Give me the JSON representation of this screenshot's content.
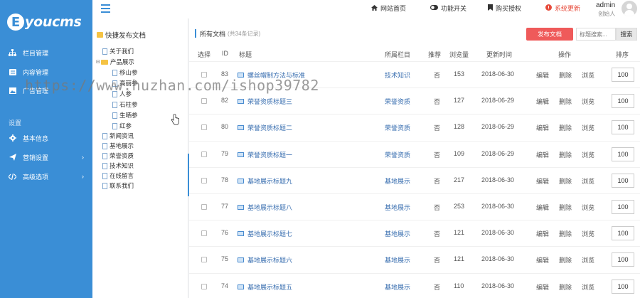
{
  "brand": {
    "logo_letter": "E",
    "logo_text": "youcms"
  },
  "sidebar": {
    "items": [
      {
        "label": "栏目管理",
        "icon": "sitemap-icon"
      },
      {
        "label": "内容管理",
        "icon": "list-icon"
      },
      {
        "label": "广告管理",
        "icon": "image-icon"
      }
    ],
    "section_label": "设置",
    "settings_items": [
      {
        "label": "基本信息",
        "icon": "gear-icon"
      },
      {
        "label": "营销设置",
        "icon": "send-icon"
      },
      {
        "label": "高级选项",
        "icon": "code-icon"
      }
    ]
  },
  "topbar": {
    "links": [
      {
        "label": "网站首页",
        "icon": "home-icon"
      },
      {
        "label": "功能开关",
        "icon": "toggle-icon"
      },
      {
        "label": "购买授权",
        "icon": "bookmark-icon"
      },
      {
        "label": "系统更新",
        "icon": "alert-icon"
      }
    ],
    "admin_name": "admin",
    "admin_role": "创始人"
  },
  "tree": {
    "title": "快捷发布文档",
    "nodes": [
      {
        "label": "关于我们"
      },
      {
        "label": "产品展示"
      },
      {
        "label": "移山参"
      },
      {
        "label": "高丽参"
      },
      {
        "label": "人参"
      },
      {
        "label": "石柱参"
      },
      {
        "label": "生晒参"
      },
      {
        "label": "红参"
      },
      {
        "label": "新闻资讯"
      },
      {
        "label": "基地展示"
      },
      {
        "label": "荣誉资质"
      },
      {
        "label": "技术知识"
      },
      {
        "label": "在线留言"
      },
      {
        "label": "联系我们"
      }
    ]
  },
  "content": {
    "breadcrumb": "所有文档",
    "record_count": "(共34条记录)",
    "publish_button": "发布文档",
    "search_placeholder": "标题搜索...",
    "search_button": "搜索",
    "columns": {
      "select": "选择",
      "id": "ID",
      "title": "标题",
      "category": "所属栏目",
      "recommend": "推荐",
      "views": "浏览量",
      "updated": "更新时间",
      "ops": "操作",
      "sort": "排序"
    },
    "op_labels": {
      "edit": "编辑",
      "delete": "删除",
      "view": "浏览"
    },
    "rows": [
      {
        "id": "83",
        "title": "螺丝帽制方法与标准",
        "category": "技术知识",
        "recommend": "否",
        "views": "153",
        "updated": "2018-06-30",
        "sort": "100"
      },
      {
        "id": "82",
        "title": "荣誉资质标题三",
        "category": "荣誉资质",
        "recommend": "否",
        "views": "127",
        "updated": "2018-06-29",
        "sort": "100"
      },
      {
        "id": "80",
        "title": "荣誉资质标题二",
        "category": "荣誉资质",
        "recommend": "否",
        "views": "128",
        "updated": "2018-06-29",
        "sort": "100"
      },
      {
        "id": "79",
        "title": "荣誉资质标题一",
        "category": "荣誉资质",
        "recommend": "否",
        "views": "109",
        "updated": "2018-06-29",
        "sort": "100"
      },
      {
        "id": "78",
        "title": "基地展示标题九",
        "category": "基地展示",
        "recommend": "否",
        "views": "217",
        "updated": "2018-06-30",
        "sort": "100"
      },
      {
        "id": "77",
        "title": "基地展示标题八",
        "category": "基地展示",
        "recommend": "否",
        "views": "253",
        "updated": "2018-06-30",
        "sort": "100"
      },
      {
        "id": "76",
        "title": "基地展示标题七",
        "category": "基地展示",
        "recommend": "否",
        "views": "121",
        "updated": "2018-06-30",
        "sort": "100"
      },
      {
        "id": "75",
        "title": "基地展示标题六",
        "category": "基地展示",
        "recommend": "否",
        "views": "121",
        "updated": "2018-06-30",
        "sort": "100"
      },
      {
        "id": "74",
        "title": "基地展示标题五",
        "category": "基地展示",
        "recommend": "否",
        "views": "110",
        "updated": "2018-06-30",
        "sort": "100"
      }
    ]
  },
  "watermark": "https://www.huzhan.com/ishop39782",
  "colors": {
    "accent": "#3a8ed6",
    "danger": "#ef5a5a",
    "link": "#3a6fb0"
  }
}
